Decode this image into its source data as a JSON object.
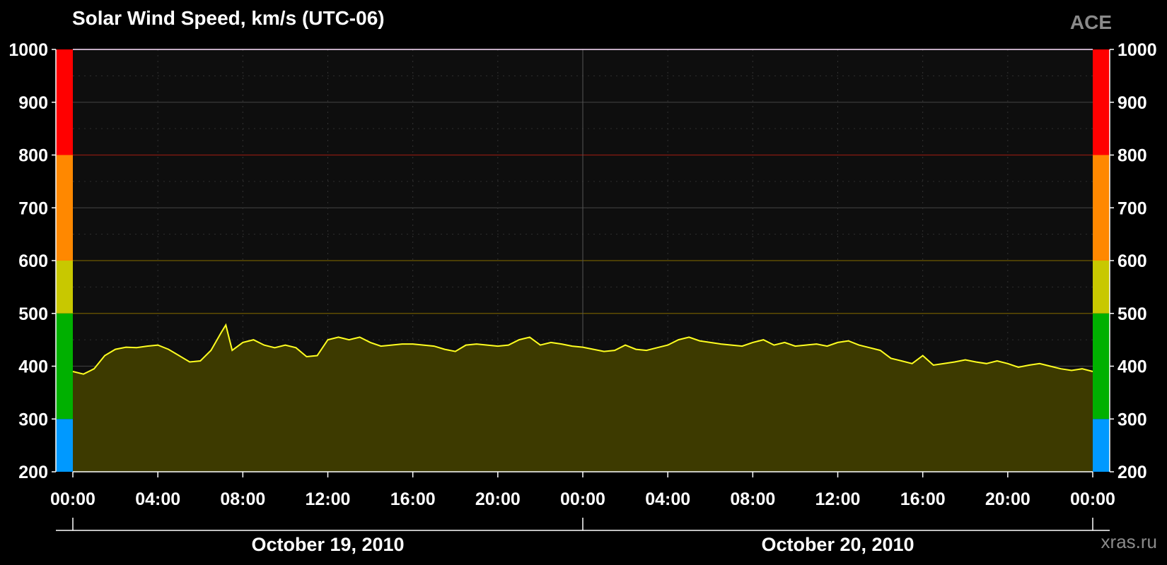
{
  "title": "Solar Wind Speed, km/s (UTC-06)",
  "source": "ACE",
  "watermark": "xras.ru",
  "colors": {
    "line": "#ffff20",
    "fill": "#3d3a00",
    "plot_bg": "#0e0e0e",
    "band_blue": "#0099ff",
    "band_green": "#00b000",
    "band_yellow": "#c8c800",
    "band_orange": "#ff8800",
    "band_red": "#ff0000"
  },
  "chart_data": {
    "type": "area",
    "title": "Solar Wind Speed, km/s (UTC-06)",
    "xlabel": "",
    "ylabel": "",
    "ylim": [
      200,
      1000
    ],
    "xlim_hours": [
      0,
      48
    ],
    "y_ticks": [
      "200",
      "300",
      "400",
      "500",
      "600",
      "700",
      "800",
      "900",
      "1000"
    ],
    "x_tick_labels": [
      "00:00",
      "04:00",
      "08:00",
      "12:00",
      "16:00",
      "20:00",
      "00:00",
      "04:00",
      "08:00",
      "12:00",
      "16:00",
      "20:00",
      "00:00"
    ],
    "dates": [
      "October 19, 2010",
      "October 20, 2010"
    ],
    "threshold_lines": [
      500,
      600,
      800
    ],
    "color_bands": [
      {
        "from": 200,
        "to": 300,
        "color": "#0099ff"
      },
      {
        "from": 300,
        "to": 500,
        "color": "#00b000"
      },
      {
        "from": 500,
        "to": 600,
        "color": "#c8c800"
      },
      {
        "from": 600,
        "to": 800,
        "color": "#ff8800"
      },
      {
        "from": 800,
        "to": 1000,
        "color": "#ff0000"
      }
    ],
    "grid": true,
    "series": [
      {
        "x_hours": [
          0,
          0.5,
          1,
          1.5,
          2,
          2.5,
          3,
          3.5,
          4,
          4.5,
          5,
          5.5,
          6,
          6.5,
          7,
          7.2,
          7.5,
          8,
          8.5,
          9,
          9.5,
          10,
          10.5,
          11,
          11.5,
          12,
          12.5,
          13,
          13.5,
          14,
          14.5,
          15,
          15.5,
          16,
          16.5,
          17,
          17.5,
          18,
          18.5,
          19,
          19.5,
          20,
          20.5,
          21,
          21.5,
          22,
          22.5,
          23,
          23.5,
          24,
          24.5,
          25,
          25.5,
          26,
          26.5,
          27,
          27.5,
          28,
          28.5,
          29,
          29.5,
          30,
          30.5,
          31,
          31.5,
          32,
          32.5,
          33,
          33.5,
          34,
          34.5,
          35,
          35.5,
          36,
          36.5,
          37,
          37.5,
          38,
          38.5,
          39,
          39.5,
          40,
          40.5,
          41,
          41.5,
          42,
          42.5,
          43,
          43.5,
          44,
          44.5,
          45,
          45.5,
          46,
          46.5,
          47,
          47.5,
          48
        ],
        "values": [
          390,
          385,
          395,
          420,
          432,
          436,
          435,
          438,
          440,
          432,
          420,
          408,
          410,
          430,
          465,
          478,
          430,
          445,
          450,
          440,
          435,
          440,
          435,
          418,
          420,
          450,
          455,
          450,
          455,
          445,
          438,
          440,
          442,
          442,
          440,
          438,
          432,
          428,
          440,
          442,
          440,
          438,
          440,
          450,
          455,
          440,
          445,
          442,
          438,
          436,
          432,
          428,
          430,
          440,
          432,
          430,
          435,
          440,
          450,
          455,
          448,
          445,
          442,
          440,
          438,
          445,
          450,
          440,
          445,
          438,
          440,
          442,
          438,
          445,
          448,
          440,
          435,
          430,
          415,
          410,
          405,
          420,
          402,
          405,
          408,
          412,
          408,
          405,
          410,
          405,
          398,
          402,
          405,
          400,
          395,
          392,
          395,
          390
        ]
      }
    ]
  }
}
